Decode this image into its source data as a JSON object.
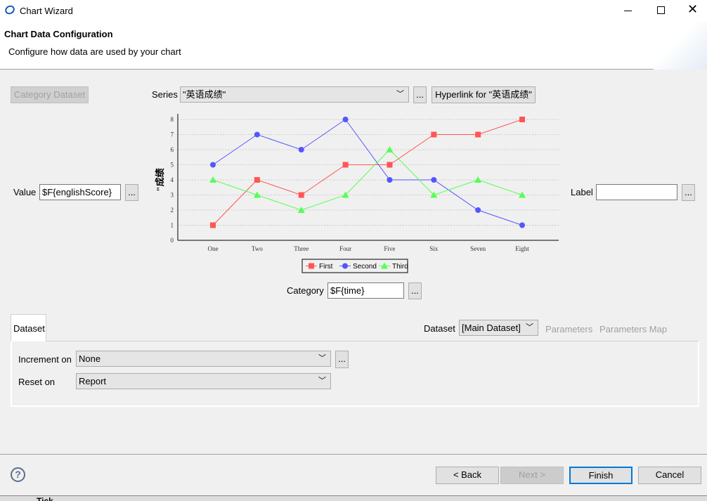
{
  "window": {
    "title": "Chart Wizard",
    "minimize_icon": "minimize-icon",
    "maximize_icon": "maximize-icon",
    "close_icon": "close-icon"
  },
  "header": {
    "title": "Chart Data Configuration",
    "subtitle": "Configure how data are used by your chart"
  },
  "top": {
    "category_dataset": "Category Dataset",
    "series_label": "Series",
    "series_value": "\"英语成绩\"",
    "ellipsis": "...",
    "hyperlink": "Hyperlink for \"英语成绩\""
  },
  "value": {
    "label": "Value",
    "value": "$F{englishScore}",
    "ellipsis": "..."
  },
  "labelfield": {
    "label": "Label",
    "value": "",
    "ellipsis": "..."
  },
  "category": {
    "label": "Category",
    "value": "$F{time}",
    "ellipsis": "..."
  },
  "chart_data": {
    "type": "line",
    "ylabel": "\"成绩",
    "categories": [
      "One",
      "Two",
      "Three",
      "Four",
      "Five",
      "Six",
      "Seven",
      "Eight"
    ],
    "ylim": [
      0,
      8
    ],
    "yticks": [
      "0",
      "1",
      "2",
      "3",
      "4",
      "5",
      "6",
      "7",
      "8"
    ],
    "grid": true,
    "legend_placement": "bottom",
    "series": [
      {
        "name": "First",
        "color": "#ff5555",
        "marker": "square",
        "values": [
          1,
          4,
          3,
          5,
          5,
          7,
          7,
          8
        ]
      },
      {
        "name": "Second",
        "color": "#5555ff",
        "marker": "circle",
        "values": [
          5,
          7,
          6,
          8,
          4,
          4,
          2,
          1
        ]
      },
      {
        "name": "Third",
        "color": "#55ff55",
        "marker": "triangle",
        "values": [
          4,
          3,
          2,
          3,
          6,
          3,
          4,
          3
        ]
      }
    ]
  },
  "dataset_tab": {
    "tab": "Dataset",
    "dataset_label": "Dataset",
    "dataset_value": "[Main Dataset]",
    "parameters": "Parameters",
    "parameters_map": "Parameters Map"
  },
  "increment": {
    "label": "Increment on",
    "value": "None",
    "ellipsis": "..."
  },
  "reset": {
    "label": "Reset on",
    "value": "Report"
  },
  "footer": {
    "help_icon": "help-icon",
    "back": "< Back",
    "next": "Next >",
    "finish": "Finish",
    "cancel": "Cancel"
  },
  "behind": {
    "text": "Tick"
  }
}
